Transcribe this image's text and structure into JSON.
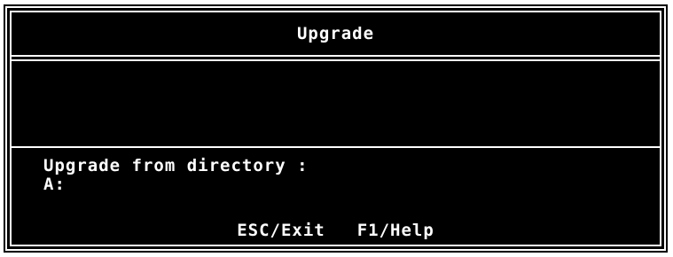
{
  "dialog": {
    "title": "Upgrade",
    "prompt_label": "Upgrade from directory :",
    "directory_value": "A:",
    "hotkeys": [
      {
        "label": "ESC/Exit"
      },
      {
        "label": "F1/Help"
      }
    ]
  },
  "colors": {
    "background": "#000000",
    "foreground": "#ffffff",
    "outer_page": "#ffffff"
  }
}
